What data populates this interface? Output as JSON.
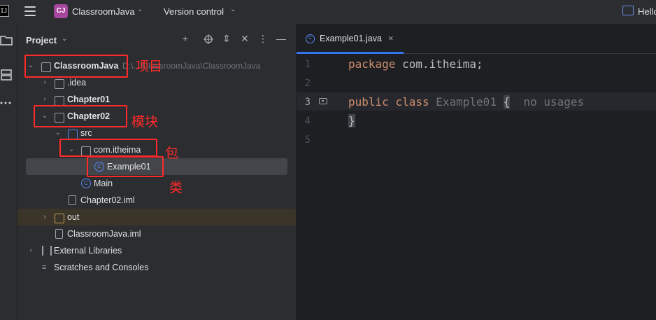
{
  "titlebar": {
    "app_icon": "intellij-icon",
    "project_badge": "CJ",
    "project_name": "ClassroomJava",
    "vcs_label": "Version control",
    "right_text": "Hello"
  },
  "project_panel": {
    "title": "Project",
    "tree": [
      {
        "label": "ClassroomJava",
        "path": "D:\\...\\ClassroomJava\\ClassroomJava",
        "icon": "module-folder-icon"
      },
      {
        "label": ".idea",
        "icon": "folder-icon"
      },
      {
        "label": "Chapter01",
        "icon": "module-folder-icon"
      },
      {
        "label": "Chapter02",
        "icon": "module-folder-icon"
      },
      {
        "label": "src",
        "icon": "source-folder-icon"
      },
      {
        "label": "com.itheima",
        "icon": "package-icon"
      },
      {
        "label": "Example01",
        "icon": "class-icon"
      },
      {
        "label": "Main",
        "icon": "main-class-icon"
      },
      {
        "label": "Chapter02.iml",
        "icon": "iml-file-icon"
      },
      {
        "label": "out",
        "icon": "excluded-folder-icon"
      },
      {
        "label": "ClassroomJava.iml",
        "icon": "iml-file-icon"
      },
      {
        "label": "External Libraries",
        "icon": "library-icon"
      },
      {
        "label": "Scratches and Consoles",
        "icon": "scratches-icon"
      }
    ]
  },
  "annotations": {
    "project": "项目",
    "module": "模块",
    "package": "包",
    "class": "类"
  },
  "editor": {
    "tab_label": "Example01.java",
    "line_numbers": [
      "1",
      "2",
      "3",
      "4",
      "5"
    ],
    "code": {
      "line1_kw": "package",
      "line1_rest": " com.itheima;",
      "line3_kw1": "public",
      "line3_kw2": "class",
      "line3_name": "Example01",
      "line3_brace": "{",
      "line3_hint": "no usages",
      "line4": "}"
    }
  },
  "colors": {
    "accent": "#3574f0",
    "annotation_red": "#ff2a2a",
    "keyword": "#cf8e6d"
  }
}
